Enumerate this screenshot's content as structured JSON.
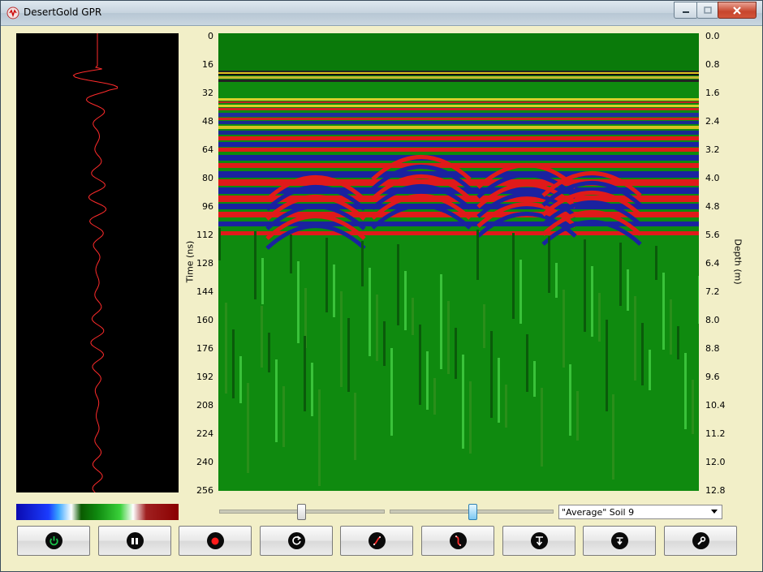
{
  "window": {
    "title": "DesertGold GPR"
  },
  "axes": {
    "time_label": "Time (ns)",
    "depth_label": "Depth (m)",
    "time_ticks": [
      "0",
      "16",
      "32",
      "48",
      "64",
      "80",
      "96",
      "112",
      "128",
      "144",
      "160",
      "176",
      "192",
      "208",
      "224",
      "240",
      "256"
    ],
    "depth_ticks": [
      "0.0",
      "0.8",
      "1.6",
      "2.4",
      "3.2",
      "4.0",
      "4.8",
      "5.6",
      "6.4",
      "7.2",
      "8.0",
      "8.8",
      "9.6",
      "10.4",
      "11.2",
      "12.0",
      "12.8"
    ]
  },
  "controls": {
    "gain_slider": {
      "value": 0.5
    },
    "contrast_slider": {
      "value": 0.51
    },
    "soil_select": {
      "value": "\"Average\" Soil  9"
    }
  },
  "toolbar": {
    "buttons": [
      {
        "name": "power",
        "icon": "power-icon"
      },
      {
        "name": "pause",
        "icon": "pause-icon"
      },
      {
        "name": "record",
        "icon": "record-icon"
      },
      {
        "name": "reset",
        "icon": "refresh-icon"
      },
      {
        "name": "gain-curve",
        "icon": "curve-icon"
      },
      {
        "name": "filter",
        "icon": "wave-icon"
      },
      {
        "name": "depth",
        "icon": "depth-icon"
      },
      {
        "name": "save",
        "icon": "download-icon"
      },
      {
        "name": "settings",
        "icon": "wrench-icon"
      }
    ]
  },
  "colors": {
    "window_bg": "#f4f1cb",
    "radar_green": "#0f8a0f",
    "trace_red": "#ff2b2b"
  }
}
